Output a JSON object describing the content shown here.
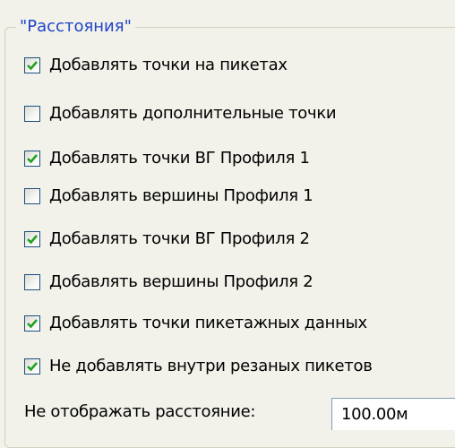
{
  "group": {
    "title": "\"Расстояния\""
  },
  "checkboxes": [
    {
      "label": "Добавлять точки на пикетах",
      "checked": true
    },
    {
      "label": "Добавлять дополнительные точки",
      "checked": false
    },
    {
      "label": "Добавлять точки ВГ Профиля 1",
      "checked": true
    },
    {
      "label": "Добавлять вершины Профиля 1",
      "checked": false
    },
    {
      "label": "Добавлять точки ВГ Профиля 2",
      "checked": true
    },
    {
      "label": "Добавлять вершины Профиля 2",
      "checked": false
    },
    {
      "label": "Добавлять точки пикетажных данных",
      "checked": true
    },
    {
      "label": "Не добавлять внутри резаных пикетов",
      "checked": true
    }
  ],
  "distance": {
    "label": "Не отображать расстояние:",
    "value": "100.00м"
  },
  "colors": {
    "title": "#1e44c8",
    "check": "#21a121",
    "checkbox_border": "#1c5180"
  }
}
